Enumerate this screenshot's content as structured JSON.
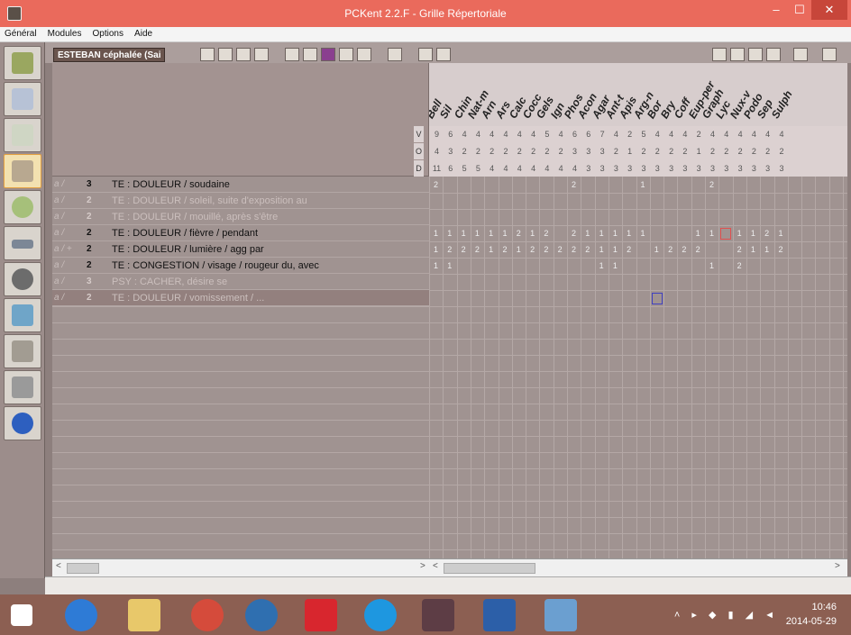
{
  "window": {
    "title": "PCKent 2.2.F - Grille Répertoriale",
    "minimize": "–",
    "maximize": "☐",
    "close": "✕"
  },
  "menu": [
    "Général",
    "Modules",
    "Options",
    "Aide"
  ],
  "toolbar": {
    "patient_label": "ESTEBAN céphalée (Sai"
  },
  "row_labels": [
    "V",
    "O",
    "D"
  ],
  "remedies": [
    "Bell",
    "Sil",
    "Chin",
    "Nat-m",
    "Arn",
    "Ars",
    "Calc",
    "Cocc",
    "Gels",
    "Ign",
    "Phos",
    "Acon",
    "Agar",
    "Ant-t",
    "Apis",
    "Arg-n",
    "Bor",
    "Bry",
    "Coff",
    "Eup-per",
    "Graph",
    "Lyc",
    "Nux-v",
    "Podo",
    "Sep",
    "Sulph"
  ],
  "totals": {
    "V": [
      "9",
      "6",
      "4",
      "4",
      "4",
      "4",
      "4",
      "4",
      "5",
      "4",
      "6",
      "6",
      "7",
      "4",
      "2",
      "5",
      "4",
      "4",
      "4",
      "2",
      "4",
      "4",
      "4",
      "4",
      "4",
      "4"
    ],
    "O": [
      "4",
      "3",
      "2",
      "2",
      "2",
      "2",
      "2",
      "2",
      "2",
      "2",
      "3",
      "3",
      "3",
      "2",
      "1",
      "2",
      "2",
      "2",
      "2",
      "1",
      "2",
      "2",
      "2",
      "2",
      "2",
      "2"
    ],
    "D": [
      "11",
      "6",
      "5",
      "5",
      "4",
      "4",
      "4",
      "4",
      "4",
      "4",
      "4",
      "3",
      "3",
      "3",
      "3",
      "3",
      "3",
      "3",
      "3",
      "3",
      "3",
      "3",
      "3",
      "3",
      "3",
      "3"
    ]
  },
  "rubrics": [
    {
      "mark": "a /",
      "level": "3",
      "text": "TE  : DOULEUR / soudaine",
      "dim": false
    },
    {
      "mark": "a /",
      "level": "2",
      "text": "TE  : DOULEUR / soleil, suite d'exposition au",
      "dim": true
    },
    {
      "mark": "a /",
      "level": "2",
      "text": "TE  : DOULEUR / mouillé, après s'être",
      "dim": true
    },
    {
      "mark": "a /",
      "level": "2",
      "text": "TE  : DOULEUR / fièvre / pendant",
      "dim": false
    },
    {
      "mark": "a / +",
      "level": "2",
      "text": "TE  : DOULEUR / lumière / agg par",
      "dim": false
    },
    {
      "mark": "a /",
      "level": "2",
      "text": "TE  : CONGESTION / visage / rougeur du, avec",
      "dim": false
    },
    {
      "mark": "a /",
      "level": "3",
      "text": "PSY : CACHER, désire se",
      "dim": true
    },
    {
      "mark": "a /",
      "level": "2",
      "text": "TE  : DOULEUR / vomissement / ...",
      "dim": true
    }
  ],
  "grid_values": [
    [
      "2",
      "",
      "",
      "",
      "",
      "",
      "",
      "",
      "",
      "",
      "2",
      "",
      "",
      "",
      "",
      "1",
      "",
      "",
      "",
      "",
      "2",
      "",
      "",
      "",
      "",
      ""
    ],
    [
      "",
      "",
      "",
      "",
      "",
      "",
      "",
      "",
      "",
      "",
      "",
      "",
      "",
      "",
      "",
      "",
      "",
      "",
      "",
      "",
      "",
      "",
      "",
      "",
      "",
      ""
    ],
    [
      "",
      "",
      "",
      "",
      "",
      "",
      "",
      "",
      "",
      "",
      "",
      "",
      "",
      "",
      "",
      "",
      "",
      "",
      "",
      "",
      "",
      "",
      "",
      "",
      "",
      ""
    ],
    [
      "1",
      "1",
      "1",
      "1",
      "1",
      "1",
      "2",
      "1",
      "2",
      "",
      "2",
      "1",
      "1",
      "1",
      "1",
      "1",
      "",
      "",
      "",
      "1",
      "1",
      "",
      "1",
      "1",
      "2",
      "1"
    ],
    [
      "1",
      "2",
      "2",
      "2",
      "1",
      "2",
      "1",
      "2",
      "2",
      "2",
      "2",
      "2",
      "1",
      "1",
      "2",
      "",
      "1",
      "2",
      "2",
      "2",
      "",
      "",
      "2",
      "1",
      "1",
      "2"
    ],
    [
      "1",
      "1",
      "",
      "",
      "",
      "",
      "",
      "",
      "",
      "",
      "",
      "",
      "1",
      "1",
      "",
      "",
      "",
      "",
      "",
      "",
      "1",
      "",
      "2",
      "",
      "",
      ""
    ],
    [
      "",
      "",
      "",
      "",
      "",
      "",
      "",
      "",
      "",
      "",
      "",
      "",
      "",
      "",
      "",
      "",
      "",
      "",
      "",
      "",
      "",
      "",
      "",
      "",
      "",
      ""
    ],
    [
      "",
      "",
      "",
      "",
      "",
      "",
      "",
      "",
      "",
      "",
      "",
      "",
      "",
      "",
      "",
      "",
      "",
      "",
      "",
      "",
      "",
      "",
      "",
      "",
      "",
      ""
    ]
  ],
  "clock": {
    "time": "10:46",
    "date": "2014-05-29"
  },
  "scroll": {
    "left_arrow": "<",
    "right_arrow": ">"
  }
}
